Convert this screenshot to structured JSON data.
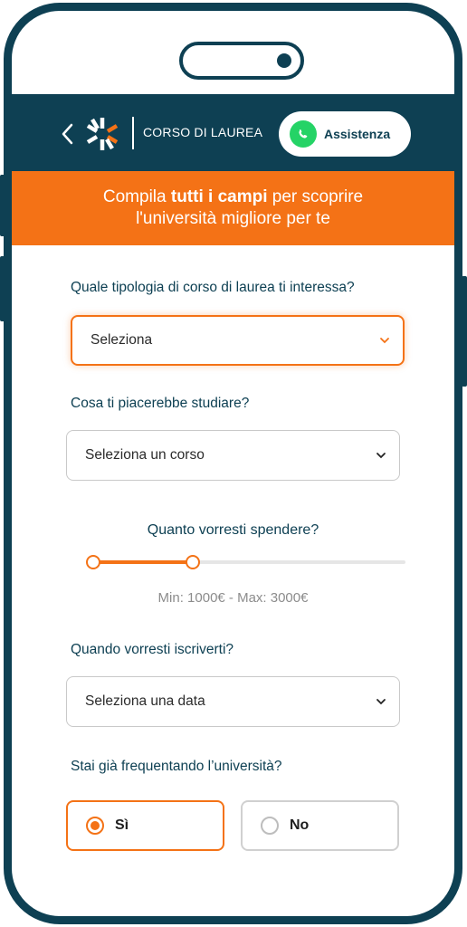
{
  "header": {
    "title": "CORSO DI LAUREA",
    "assist_label": "Assistenza",
    "back_icon": "chevron-left-icon",
    "logo_icon": "asterisk-logo"
  },
  "banner": {
    "text_before": "Compila ",
    "text_bold": "tutti i campi",
    "text_after": " per scoprire l'università migliore per te"
  },
  "form": {
    "q1_label": "Quale tipologia di corso di laurea ti interessa?",
    "q1_value": "Seleziona",
    "q2_label": "Cosa ti piacerebbe studiare?",
    "q2_value": "Seleziona un corso",
    "q3_label": "Quanto vorresti spendere?",
    "q3_caption": "Min: 1000€ - Max: 3000€",
    "q3_min_fraction": 0.0,
    "q3_max_fraction": 0.32,
    "q4_label": "Quando vorresti iscriverti?",
    "q4_value": "Seleziona una data",
    "q5_label": "Stai già frequentando l’università?",
    "q5_yes": "Sì",
    "q5_no": "No",
    "q5_selected": "yes"
  },
  "colors": {
    "brand_dark": "#0e4053",
    "accent": "#f47216",
    "whatsapp": "#25d366"
  }
}
